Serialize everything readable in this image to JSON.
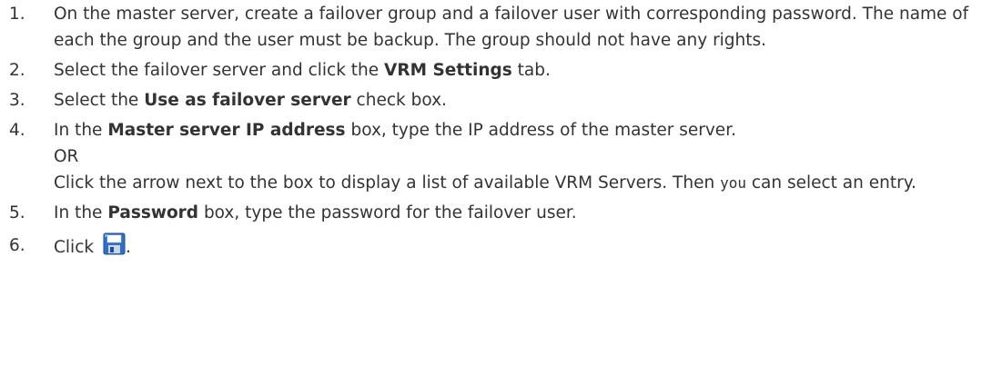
{
  "steps": [
    {
      "number": "1.",
      "text": "On the master server, create a failover group and a failover user with corresponding password. The name of each the group and the user must be backup. The group should not have any rights."
    },
    {
      "number": "2.",
      "before": "Select the failover server and click the ",
      "bold": "VRM Settings",
      "after": " tab."
    },
    {
      "number": "3.",
      "before": "Select the ",
      "bold": "Use as failover server",
      "after": " check box."
    },
    {
      "number": "4.",
      "before": "In the ",
      "bold": "Master server IP address",
      "after": " box, type the IP address of the master server.",
      "or": "OR",
      "alt_before": "Click the arrow next to the box to display a list of available VRM Servers. Then ",
      "alt_code": "you",
      "alt_after": " can select an entry."
    },
    {
      "number": "5.",
      "before": "In the ",
      "bold": "Password",
      "after": " box, type the password for the failover user."
    },
    {
      "number": "6.",
      "before": "Click ",
      "icon": "save-icon",
      "after": "."
    }
  ],
  "colors": {
    "text": "#333333",
    "icon_blue": "#2f6fc9",
    "icon_dark": "#1e4f9a"
  }
}
